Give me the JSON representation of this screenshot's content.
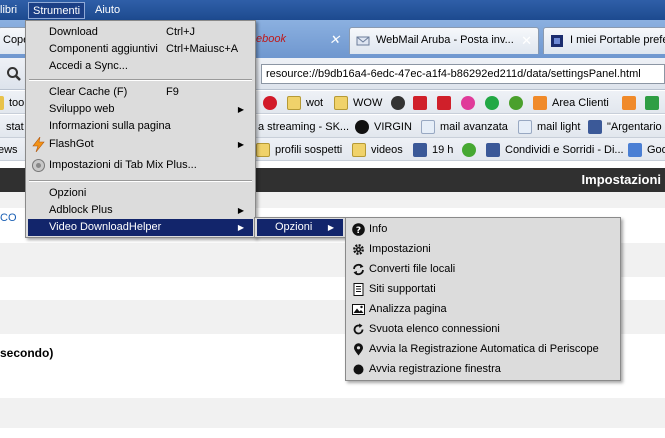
{
  "menubar": {
    "items": [
      {
        "label": "libri"
      },
      {
        "label": "Strumenti"
      },
      {
        "label": "Aiuto"
      }
    ]
  },
  "tabs": [
    {
      "label": "Cope"
    },
    {
      "label": "ebook"
    },
    {
      "label": "WebMail Aruba - Posta inv..."
    },
    {
      "label": "I miei Portable prefe"
    }
  ],
  "navbar": {
    "url": "resource://b9db16a4-6edc-47ec-a1f4-b86292ed211d/data/settingsPanel.html"
  },
  "bookmarks": {
    "row1": [
      {
        "label": "too"
      },
      {
        "label": "wot"
      },
      {
        "label": "WOW"
      },
      {
        "label": "Area Clienti"
      }
    ],
    "row2": [
      {
        "label": "stat"
      },
      {
        "label": "a streaming - SK..."
      },
      {
        "label": "VIRGIN"
      },
      {
        "label": "mail avanzata"
      },
      {
        "label": "mail light"
      },
      {
        "label": "\"Argentario"
      }
    ],
    "row3": [
      {
        "label": "ews"
      },
      {
        "label": "profili sospetti"
      },
      {
        "label": "videos"
      },
      {
        "label": "19 h"
      },
      {
        "label": "Condividi e Sorridi - Di..."
      },
      {
        "label": "Goo"
      }
    ]
  },
  "content": {
    "header_title": "Impostazioni",
    "link_fragment": "CO",
    "bold_fragment": "secondo)"
  },
  "strumenti_menu": {
    "items": [
      {
        "label": "Download",
        "shortcut": "Ctrl+J"
      },
      {
        "label": "Componenti aggiuntivi",
        "shortcut": "Ctrl+Maiusc+A"
      },
      {
        "label": "Accedi a Sync..."
      },
      {
        "label": "Clear Cache (F)",
        "shortcut": "F9"
      },
      {
        "label": "Sviluppo web"
      },
      {
        "label": "Informazioni sulla pagina"
      },
      {
        "label": "FlashGot"
      },
      {
        "label": "Impostazioni di Tab Mix Plus..."
      },
      {
        "label": "Opzioni"
      },
      {
        "label": "Adblock Plus"
      },
      {
        "label": "Video DownloadHelper"
      }
    ]
  },
  "vdh_submenu": {
    "items": [
      {
        "label": "Opzioni"
      }
    ]
  },
  "opzioni_submenu": {
    "items": [
      {
        "label": "Info"
      },
      {
        "label": "Impostazioni"
      },
      {
        "label": "Converti file locali"
      },
      {
        "label": "Siti supportati"
      },
      {
        "label": "Analizza pagina"
      },
      {
        "label": "Svuota elenco connessioni"
      },
      {
        "label": "Avvia la Registrazione Automatica di Periscope"
      },
      {
        "label": "Avvia registrazione finestra"
      }
    ]
  },
  "colors": {
    "menu_highlight": "#12256b",
    "menubar": "#1d4a8f",
    "title_strip": "#303030"
  }
}
